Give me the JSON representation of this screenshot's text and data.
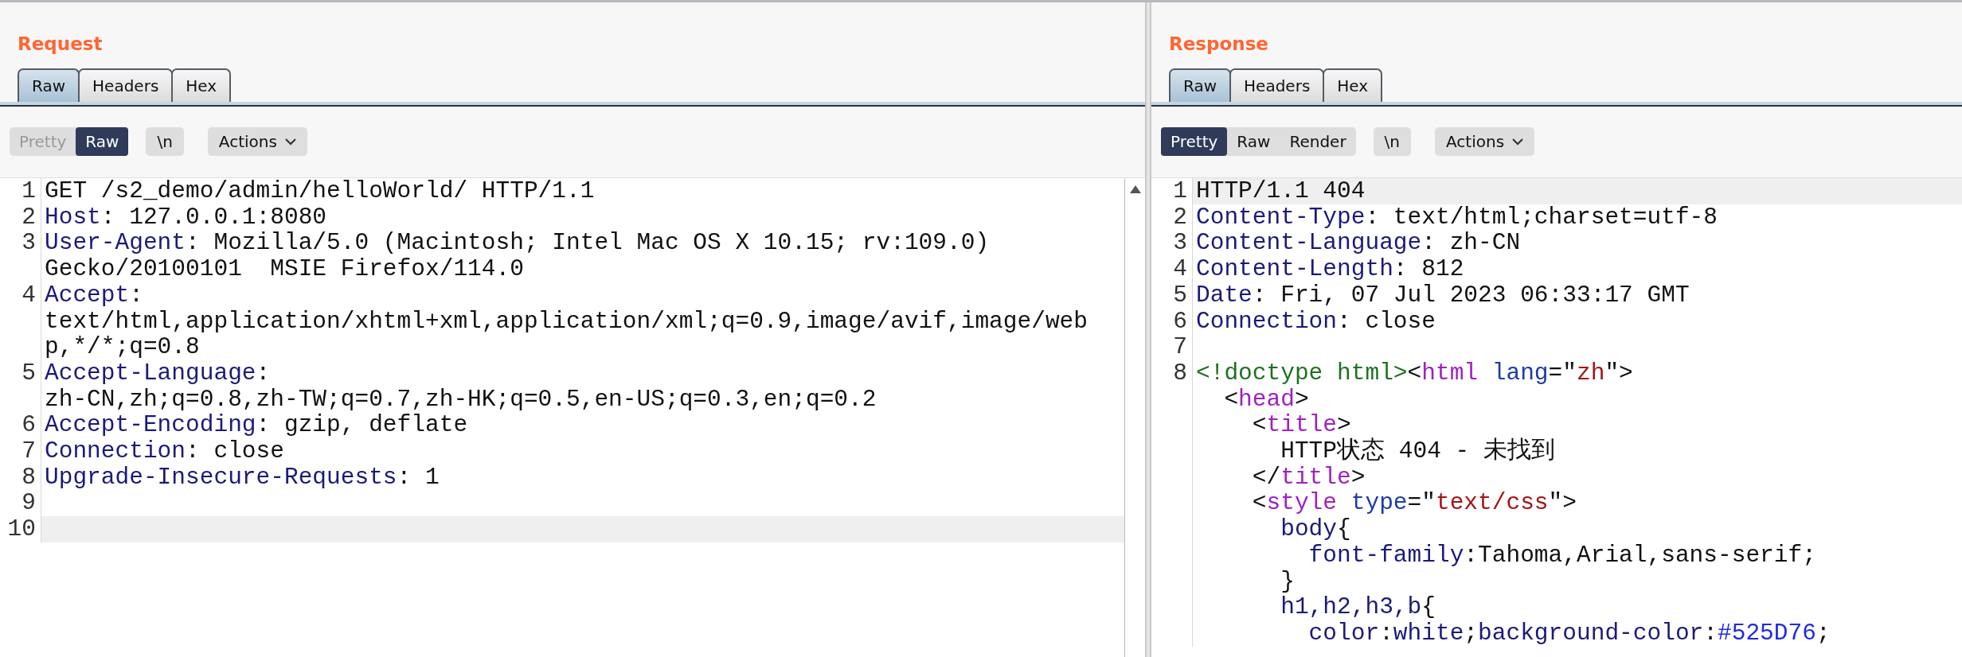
{
  "panels": [
    {
      "title": "Request",
      "scrollbar": true,
      "tabs": [
        {
          "label": "Raw",
          "selected": true
        },
        {
          "label": "Headers",
          "selected": false
        },
        {
          "label": "Hex",
          "selected": false
        }
      ],
      "view_modes": [
        {
          "label": "Pretty",
          "selected": false,
          "disabled": true
        },
        {
          "label": "Raw",
          "selected": true,
          "disabled": false
        }
      ],
      "newline_button": "\\n",
      "actions_button": "Actions",
      "lines": [
        {
          "number": "1",
          "current": false,
          "rows": [
            {
              "segments": [
                {
                  "kind": "plain",
                  "text": "GET /s2_demo/admin/helloWorld/ HTTP/1.1"
                }
              ]
            }
          ]
        },
        {
          "number": "2",
          "current": false,
          "rows": [
            {
              "segments": [
                {
                  "kind": "key",
                  "text": "Host"
                },
                {
                  "kind": "plain",
                  "text": ": 127.0.0.1:8080"
                }
              ]
            }
          ]
        },
        {
          "number": "3",
          "current": false,
          "rows": [
            {
              "segments": [
                {
                  "kind": "key",
                  "text": "User-Agent"
                },
                {
                  "kind": "plain",
                  "text": ": Mozilla/5.0 (Macintosh; Intel Mac OS X 10.15; rv:109.0)"
                }
              ]
            },
            {
              "segments": [
                {
                  "kind": "plain",
                  "text": "Gecko/20100101  MSIE Firefox/114.0"
                }
              ]
            }
          ]
        },
        {
          "number": "4",
          "current": false,
          "rows": [
            {
              "segments": [
                {
                  "kind": "key",
                  "text": "Accept"
                },
                {
                  "kind": "plain",
                  "text": ":"
                }
              ]
            },
            {
              "segments": [
                {
                  "kind": "plain",
                  "text": "text/html,application/xhtml+xml,application/xml;q=0.9,image/avif,image/web"
                }
              ]
            },
            {
              "segments": [
                {
                  "kind": "plain",
                  "text": "p,*/*;q=0.8"
                }
              ]
            }
          ]
        },
        {
          "number": "5",
          "current": false,
          "rows": [
            {
              "segments": [
                {
                  "kind": "key",
                  "text": "Accept-Language"
                },
                {
                  "kind": "plain",
                  "text": ":"
                }
              ]
            },
            {
              "segments": [
                {
                  "kind": "plain",
                  "text": "zh-CN,zh;q=0.8,zh-TW;q=0.7,zh-HK;q=0.5,en-US;q=0.3,en;q=0.2"
                }
              ]
            }
          ]
        },
        {
          "number": "6",
          "current": false,
          "rows": [
            {
              "segments": [
                {
                  "kind": "key",
                  "text": "Accept-Encoding"
                },
                {
                  "kind": "plain",
                  "text": ": gzip, deflate"
                }
              ]
            }
          ]
        },
        {
          "number": "7",
          "current": false,
          "rows": [
            {
              "segments": [
                {
                  "kind": "key",
                  "text": "Connection"
                },
                {
                  "kind": "plain",
                  "text": ": close"
                }
              ]
            }
          ]
        },
        {
          "number": "8",
          "current": false,
          "rows": [
            {
              "segments": [
                {
                  "kind": "key",
                  "text": "Upgrade-Insecure-Requests"
                },
                {
                  "kind": "plain",
                  "text": ": 1"
                }
              ]
            }
          ]
        },
        {
          "number": "9",
          "current": false
        },
        {
          "number": "10",
          "current": true
        }
      ]
    },
    {
      "title": "Response",
      "scrollbar": false,
      "tabs": [
        {
          "label": "Raw",
          "selected": true
        },
        {
          "label": "Headers",
          "selected": false
        },
        {
          "label": "Hex",
          "selected": false
        }
      ],
      "view_modes": [
        {
          "label": "Pretty",
          "selected": true,
          "disabled": false
        },
        {
          "label": "Raw",
          "selected": false,
          "disabled": false
        },
        {
          "label": "Render",
          "selected": false,
          "disabled": false
        }
      ],
      "newline_button": "\\n",
      "actions_button": "Actions",
      "lines": [
        {
          "number": "1",
          "current": true,
          "rows": [
            {
              "segments": [
                {
                  "kind": "plain",
                  "text": "HTTP/1.1 404"
                }
              ]
            }
          ]
        },
        {
          "number": "2",
          "current": false,
          "rows": [
            {
              "segments": [
                {
                  "kind": "key",
                  "text": "Content-Type"
                },
                {
                  "kind": "plain",
                  "text": ": text/html;charset=utf-8"
                }
              ]
            }
          ]
        },
        {
          "number": "3",
          "current": false,
          "rows": [
            {
              "segments": [
                {
                  "kind": "key",
                  "text": "Content-Language"
                },
                {
                  "kind": "plain",
                  "text": ": zh-CN"
                }
              ]
            }
          ]
        },
        {
          "number": "4",
          "current": false,
          "rows": [
            {
              "segments": [
                {
                  "kind": "key",
                  "text": "Content-Length"
                },
                {
                  "kind": "plain",
                  "text": ": 812"
                }
              ]
            }
          ]
        },
        {
          "number": "5",
          "current": false,
          "rows": [
            {
              "segments": [
                {
                  "kind": "key",
                  "text": "Date"
                },
                {
                  "kind": "plain",
                  "text": ": Fri, 07 Jul 2023 06:33:17 GMT"
                }
              ]
            }
          ]
        },
        {
          "number": "6",
          "current": false,
          "rows": [
            {
              "segments": [
                {
                  "kind": "key",
                  "text": "Connection"
                },
                {
                  "kind": "plain",
                  "text": ": close"
                }
              ]
            }
          ]
        },
        {
          "number": "7",
          "current": false
        },
        {
          "number": "8",
          "current": false,
          "rows": [
            {
              "segments": [
                {
                  "kind": "doctype",
                  "text": "<!doctype html>"
                },
                {
                  "kind": "plain",
                  "text": "<"
                },
                {
                  "kind": "tag",
                  "text": "html"
                },
                {
                  "kind": "attr",
                  "text": " lang"
                },
                {
                  "kind": "plain",
                  "text": "=\""
                },
                {
                  "kind": "string",
                  "text": "zh"
                },
                {
                  "kind": "plain",
                  "text": "\">"
                }
              ]
            },
            {
              "segments": [
                {
                  "kind": "plain",
                  "text": "  <"
                },
                {
                  "kind": "tag",
                  "text": "head"
                },
                {
                  "kind": "plain",
                  "text": ">"
                }
              ]
            },
            {
              "segments": [
                {
                  "kind": "plain",
                  "text": "    <"
                },
                {
                  "kind": "tag",
                  "text": "title"
                },
                {
                  "kind": "plain",
                  "text": ">"
                }
              ]
            },
            {
              "segments": [
                {
                  "kind": "plain",
                  "text": "      HTTP状态 404 - 未找到"
                }
              ]
            },
            {
              "segments": [
                {
                  "kind": "plain",
                  "text": "    </"
                },
                {
                  "kind": "tag",
                  "text": "title"
                },
                {
                  "kind": "plain",
                  "text": ">"
                }
              ]
            },
            {
              "segments": [
                {
                  "kind": "plain",
                  "text": "    <"
                },
                {
                  "kind": "tag",
                  "text": "style"
                },
                {
                  "kind": "attr",
                  "text": " type"
                },
                {
                  "kind": "plain",
                  "text": "=\""
                },
                {
                  "kind": "string",
                  "text": "text/css"
                },
                {
                  "kind": "plain",
                  "text": "\">"
                }
              ]
            },
            {
              "segments": [
                {
                  "kind": "key",
                  "text": "      body"
                },
                {
                  "kind": "plain",
                  "text": "{"
                }
              ]
            },
            {
              "segments": [
                {
                  "kind": "key",
                  "text": "        font-family"
                },
                {
                  "kind": "plain",
                  "text": ":Tahoma,Arial,sans-serif;"
                }
              ]
            },
            {
              "segments": [
                {
                  "kind": "plain",
                  "text": "      }"
                }
              ]
            },
            {
              "segments": [
                {
                  "kind": "key",
                  "text": "      h1,h2,h3,b"
                },
                {
                  "kind": "plain",
                  "text": "{"
                }
              ]
            },
            {
              "segments": [
                {
                  "kind": "key",
                  "text": "        color"
                },
                {
                  "kind": "plain",
                  "text": ":"
                },
                {
                  "kind": "key",
                  "text": "white"
                },
                {
                  "kind": "plain",
                  "text": ";"
                },
                {
                  "kind": "key",
                  "text": "background-color"
                },
                {
                  "kind": "plain",
                  "text": ":"
                },
                {
                  "kind": "literal",
                  "text": "#525D76"
                },
                {
                  "kind": "plain",
                  "text": ";"
                }
              ]
            }
          ]
        }
      ]
    }
  ]
}
